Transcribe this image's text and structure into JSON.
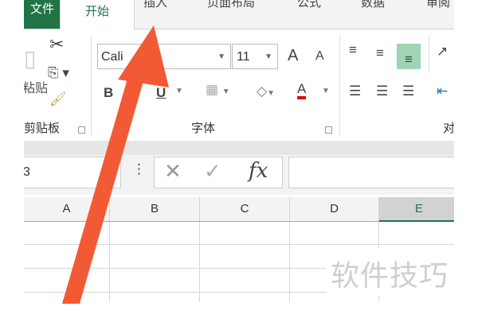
{
  "ribbon_tabs": [
    "文件",
    "开始",
    "插入",
    "页面布局",
    "公式",
    "数据",
    "审阅"
  ],
  "clipboard": {
    "paste_label": "粘贴",
    "group_label": "剪贴板"
  },
  "font": {
    "name": "Calibri",
    "name_visible": "Cali",
    "size": "11",
    "group_label": "字体",
    "bold": "B",
    "underline": "U",
    "font_color_letter": "A",
    "grow": "A",
    "shrink": "A",
    "font_color": "#e00000",
    "fill_color": "#f5e9a0"
  },
  "alignment": {
    "group_label_partial": "对"
  },
  "formula_bar": {
    "name_box": "3",
    "cancel": "✕",
    "enter": "✓",
    "fx": "fx",
    "formula": ""
  },
  "columns": [
    "A",
    "B",
    "C",
    "D",
    "E"
  ],
  "selected_column": "E",
  "watermark": "软件技巧",
  "colors": {
    "excel_green": "#217346",
    "arrow": "#f25a35"
  }
}
